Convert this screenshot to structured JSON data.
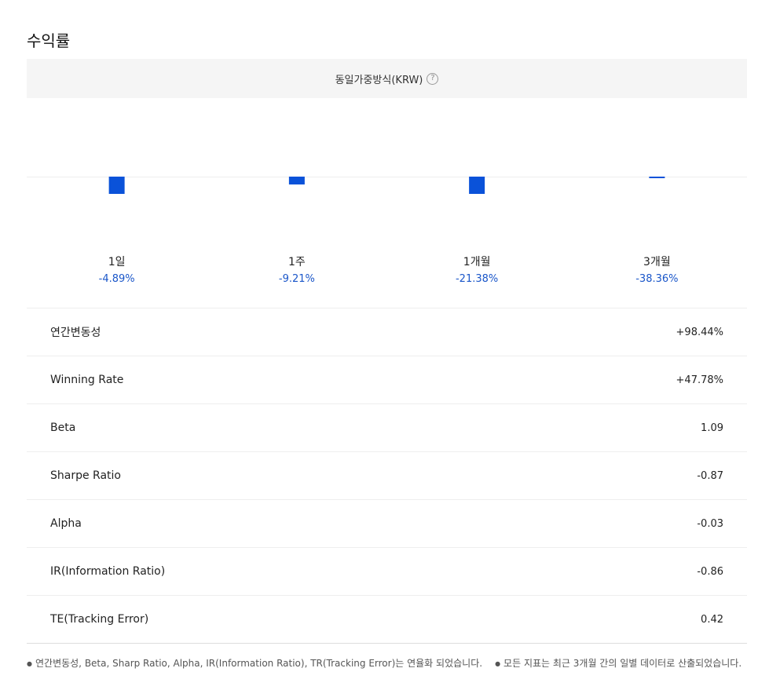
{
  "section": {
    "title": "수익률"
  },
  "method": {
    "label": "동일가중방식(KRW)",
    "help_icon": "question-circle-icon"
  },
  "colors": {
    "bar": "#0a52d9",
    "negative_text": "#1a56c9",
    "baseline": "#eeeeee"
  },
  "chart_data": {
    "type": "bar",
    "categories": [
      "1일",
      "1주",
      "1개월",
      "3개월"
    ],
    "values": [
      -4.89,
      -9.21,
      -21.38,
      -38.36
    ],
    "value_labels": [
      "-4.89%",
      "-9.21%",
      "-21.38%",
      "-38.36%"
    ]
  },
  "stats": [
    {
      "label": "연간변동성",
      "value": "+98.44%"
    },
    {
      "label": "Winning Rate",
      "value": "+47.78%"
    },
    {
      "label": "Beta",
      "value": "1.09"
    },
    {
      "label": "Sharpe Ratio",
      "value": "-0.87"
    },
    {
      "label": "Alpha",
      "value": "-0.03"
    },
    {
      "label": "IR(Information Ratio)",
      "value": "-0.86"
    },
    {
      "label": "TE(Tracking Error)",
      "value": "0.42"
    }
  ],
  "notes": [
    "연간변동성, Beta, Sharp Ratio, Alpha, IR(Information Ratio), TR(Tracking Error)는 연율화 되었습니다.",
    "모든 지표는 최근 3개월 간의 일별 데이터로 산출되었습니다."
  ]
}
